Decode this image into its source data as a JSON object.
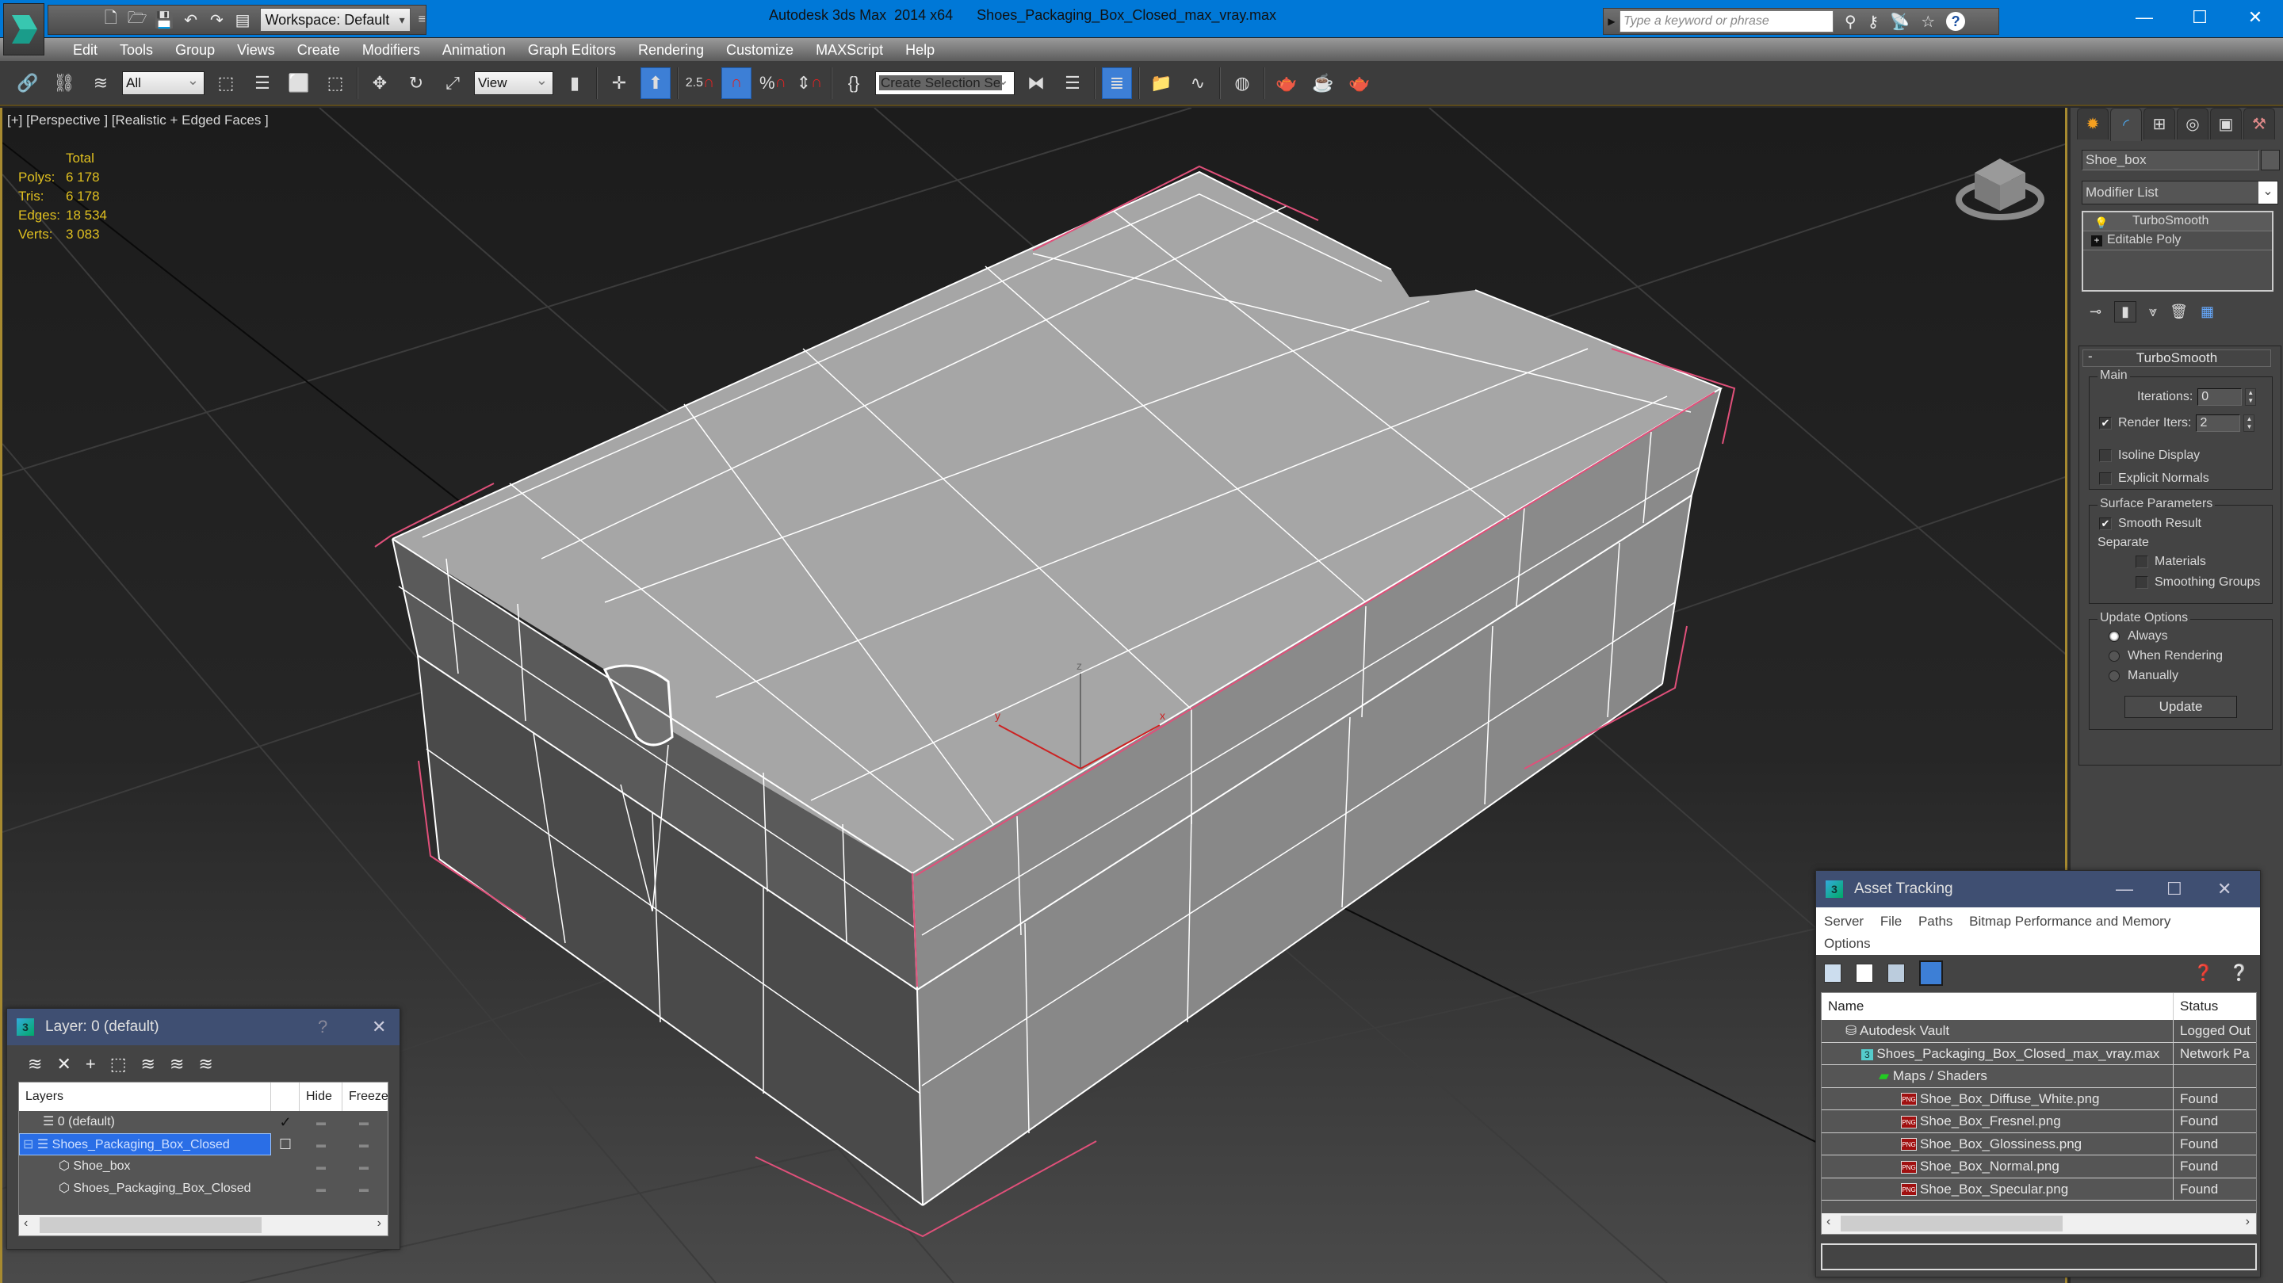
{
  "window": {
    "app_title": "Autodesk 3ds Max  2014 x64",
    "file_title": "Shoes_Packaging_Box_Closed_max_vray.max",
    "workspace": "Workspace: Default",
    "search_placeholder": "Type a keyword or phrase",
    "controls": [
      "minimize",
      "maximize",
      "close"
    ],
    "accent_color": "#0078d7"
  },
  "menu": [
    "Edit",
    "Tools",
    "Group",
    "Views",
    "Create",
    "Modifiers",
    "Animation",
    "Graph Editors",
    "Rendering",
    "Customize",
    "MAXScript",
    "Help"
  ],
  "toolbar": {
    "selection_filter": "All",
    "reference_coord": "View",
    "snap_angle": "2.5",
    "named_selection_placeholder": "Create Selection Se"
  },
  "viewport": {
    "label": "[+] [Perspective ] [Realistic + Edged Faces ]",
    "stats": {
      "header": "Total",
      "rows": [
        {
          "key": "Polys:",
          "value": "6 178"
        },
        {
          "key": "Tris:",
          "value": "6 178"
        },
        {
          "key": "Edges:",
          "value": "18 534"
        },
        {
          "key": "Verts:",
          "value": "3 083"
        }
      ]
    },
    "gizmo_labels": {
      "x": "x",
      "y": "y",
      "z": "z"
    }
  },
  "command_panel": {
    "object_name": "Shoe_box",
    "modifier_list": "Modifier List",
    "stack": [
      "TurboSmooth",
      "Editable Poly"
    ],
    "rollout_title": "TurboSmooth",
    "main_group": "Main",
    "iterations_label": "Iterations:",
    "iterations_value": "0",
    "render_iters_label": "Render Iters:",
    "render_iters_value": "2",
    "render_iters_checked": true,
    "isoline_label": "Isoline Display",
    "explicit_normals_label": "Explicit Normals",
    "surface_group": "Surface Parameters",
    "smooth_result_label": "Smooth Result",
    "separate_label": "Separate",
    "materials_label": "Materials",
    "smoothing_groups_label": "Smoothing Groups",
    "update_group": "Update Options",
    "update_options": [
      "Always",
      "When Rendering",
      "Manually"
    ],
    "update_selected": "Always",
    "update_button": "Update"
  },
  "layer_panel": {
    "title": "Layer: 0 (default)",
    "help": "?",
    "columns": [
      "Layers",
      "",
      "Hide",
      "Freeze"
    ],
    "rows": [
      {
        "name": "0 (default)",
        "current": "✓",
        "type": "layer"
      },
      {
        "name": "Shoes_Packaging_Box_Closed",
        "current": "☐",
        "type": "layer",
        "selected": true
      },
      {
        "name": "Shoe_box",
        "current": "",
        "type": "object"
      },
      {
        "name": "Shoes_Packaging_Box_Closed",
        "current": "",
        "type": "object"
      }
    ]
  },
  "asset_panel": {
    "title": "Asset Tracking",
    "menu": [
      "Server",
      "File",
      "Paths",
      "Bitmap Performance and Memory",
      "Options"
    ],
    "columns": [
      "Name",
      "Status"
    ],
    "rows": [
      {
        "name": "Autodesk Vault",
        "status": "Logged Out",
        "icon": "vault",
        "indent": 1
      },
      {
        "name": "Shoes_Packaging_Box_Closed_max_vray.max",
        "status": "Network Pa",
        "icon": "max",
        "indent": 2
      },
      {
        "name": "Maps / Shaders",
        "status": "",
        "icon": "maps",
        "indent": 3
      },
      {
        "name": "Shoe_Box_Diffuse_White.png",
        "status": "Found",
        "icon": "png",
        "indent": 4
      },
      {
        "name": "Shoe_Box_Fresnel.png",
        "status": "Found",
        "icon": "png",
        "indent": 4
      },
      {
        "name": "Shoe_Box_Glossiness.png",
        "status": "Found",
        "icon": "png",
        "indent": 4
      },
      {
        "name": "Shoe_Box_Normal.png",
        "status": "Found",
        "icon": "png",
        "indent": 4
      },
      {
        "name": "Shoe_Box_Specular.png",
        "status": "Found",
        "icon": "png",
        "indent": 4
      }
    ]
  }
}
